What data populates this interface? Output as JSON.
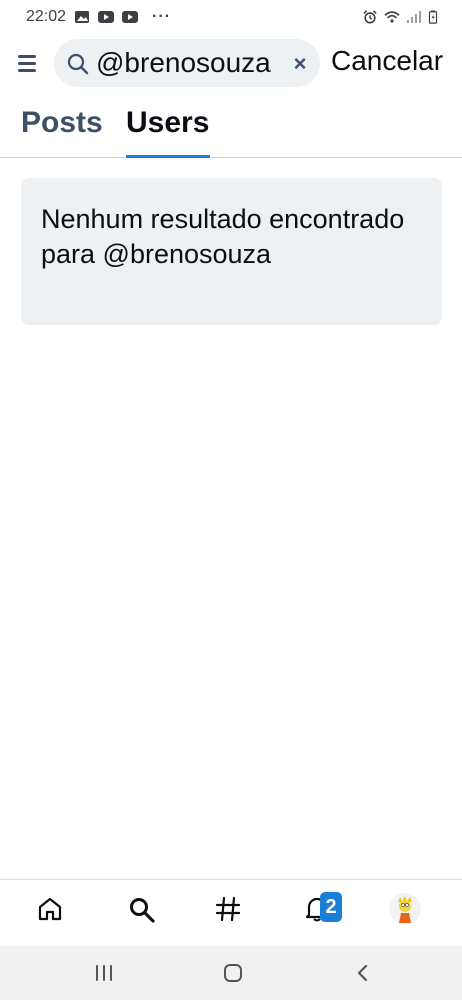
{
  "status_bar": {
    "time": "22:02",
    "more": "···"
  },
  "search": {
    "value": "@brenosouza",
    "clear": "×",
    "cancel_label": "Cancelar"
  },
  "tabs": [
    {
      "label": "Posts",
      "selected": false
    },
    {
      "label": "Users",
      "selected": true
    }
  ],
  "results": {
    "empty_message": "Nenhum resultado encontrado para @brenosouza"
  },
  "bottom_nav": {
    "items": [
      "home-icon",
      "search-icon",
      "hashtag-icon",
      "notifications-icon",
      "avatar"
    ],
    "notification_count": "2"
  },
  "system_nav": {
    "items": [
      "recents-icon",
      "home-icon",
      "back-icon"
    ]
  },
  "colors": {
    "accent": "#1a7fd6",
    "tab_inactive": "#3d5166",
    "card_bg": "#eef1f4"
  }
}
